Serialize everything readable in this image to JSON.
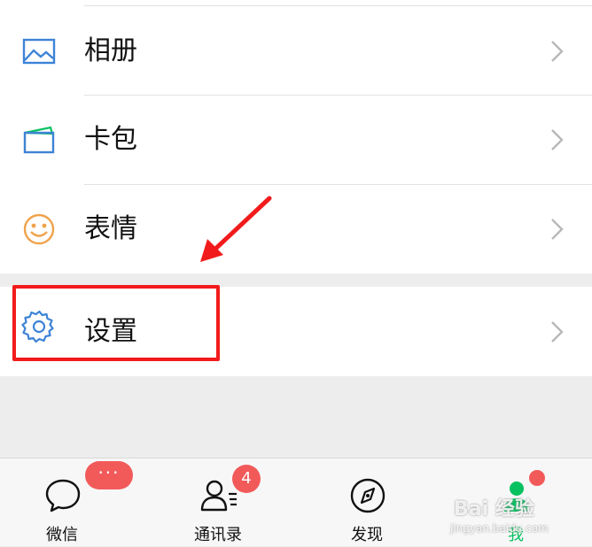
{
  "menu": {
    "items": [
      {
        "label": "相册",
        "icon": "photo-album-icon"
      },
      {
        "label": "卡包",
        "icon": "card-wallet-icon"
      },
      {
        "label": "表情",
        "icon": "sticker-smiley-icon"
      }
    ],
    "settings": {
      "label": "设置",
      "icon": "gear-icon"
    }
  },
  "tabbar": {
    "tabs": [
      {
        "label": "微信",
        "icon": "chat-bubble-icon",
        "badge": "···"
      },
      {
        "label": "通讯录",
        "icon": "contacts-icon",
        "badge": "4"
      },
      {
        "label": "发现",
        "icon": "compass-icon"
      },
      {
        "label": "我",
        "icon": "person-icon",
        "active": true
      }
    ]
  },
  "watermark": {
    "text": "Bai 经验",
    "sub": "jingyan.baidu.com"
  },
  "colors": {
    "accent_green": "#07c160",
    "badge_red": "#f25a5a",
    "annotation_red": "#f21b1b",
    "icon_blue": "#3d83d6",
    "icon_orange": "#f0a24b"
  }
}
